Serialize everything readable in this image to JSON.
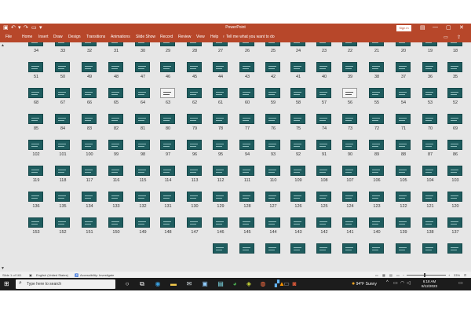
{
  "window": {
    "title": "PowerPoint",
    "signin_label": "Sign in",
    "min_glyph": "—",
    "max_glyph": "▢",
    "close_glyph": "✕",
    "quick_access": [
      "save-icon",
      "undo-icon",
      "redo-icon",
      "slideshow-icon",
      "customize-icon"
    ]
  },
  "ribbon": {
    "tabs": [
      "File",
      "Home",
      "Insert",
      "Draw",
      "Design",
      "Transitions",
      "Animations",
      "Slide Show",
      "Record",
      "Review",
      "View",
      "Help"
    ],
    "tell_me": "Tell me what you want to do",
    "right_icons": [
      "comments-icon",
      "share-icon"
    ]
  },
  "sorter": {
    "rows": [
      {
        "numbers": [
          34,
          33,
          32,
          31,
          30,
          29,
          28,
          27,
          26,
          25,
          24,
          23,
          22,
          21,
          20,
          19,
          18
        ]
      },
      {
        "numbers": [
          51,
          50,
          49,
          48,
          47,
          46,
          45,
          44,
          43,
          42,
          41,
          40,
          39,
          38,
          37,
          36,
          35
        ]
      },
      {
        "numbers": [
          68,
          67,
          66,
          65,
          64,
          63,
          62,
          61,
          60,
          59,
          58,
          57,
          56,
          55,
          54,
          53,
          52
        ],
        "white": [
          63,
          56
        ]
      },
      {
        "numbers": [
          85,
          84,
          83,
          82,
          81,
          80,
          79,
          78,
          77,
          76,
          75,
          74,
          73,
          72,
          71,
          70,
          69
        ]
      },
      {
        "numbers": [
          102,
          101,
          100,
          99,
          98,
          97,
          96,
          95,
          94,
          93,
          92,
          91,
          90,
          89,
          88,
          87,
          86
        ]
      },
      {
        "numbers": [
          119,
          118,
          117,
          116,
          115,
          114,
          113,
          112,
          111,
          110,
          109,
          108,
          107,
          106,
          105,
          104,
          103
        ]
      },
      {
        "numbers": [
          136,
          135,
          134,
          133,
          132,
          131,
          130,
          129,
          128,
          127,
          126,
          125,
          124,
          123,
          122,
          121,
          120
        ]
      },
      {
        "numbers": [
          153,
          152,
          151,
          150,
          149,
          148,
          147,
          146,
          145,
          144,
          143,
          142,
          141,
          140,
          139,
          138,
          137
        ]
      }
    ],
    "partial_row_count": 10
  },
  "status": {
    "slide_info": "Slide 1 of 161",
    "language": "English (United States)",
    "accessibility": "Accessibility: Investigate",
    "zoom": "33%"
  },
  "taskbar": {
    "search_placeholder": "Type here to search",
    "apps": [
      "cortana-icon",
      "task-view-icon",
      "edge-icon",
      "explorer-icon",
      "mail-icon",
      "photos-icon",
      "store-icon",
      "chrome-icon",
      "app-icon",
      "firefox-icon",
      "app-icon",
      "vlc-icon",
      "terminal-icon",
      "powerpoint-icon"
    ],
    "weather_temp": "94°F",
    "weather_cond": "Sunny",
    "time": "6:18 AM",
    "date": "8/12/2023"
  }
}
